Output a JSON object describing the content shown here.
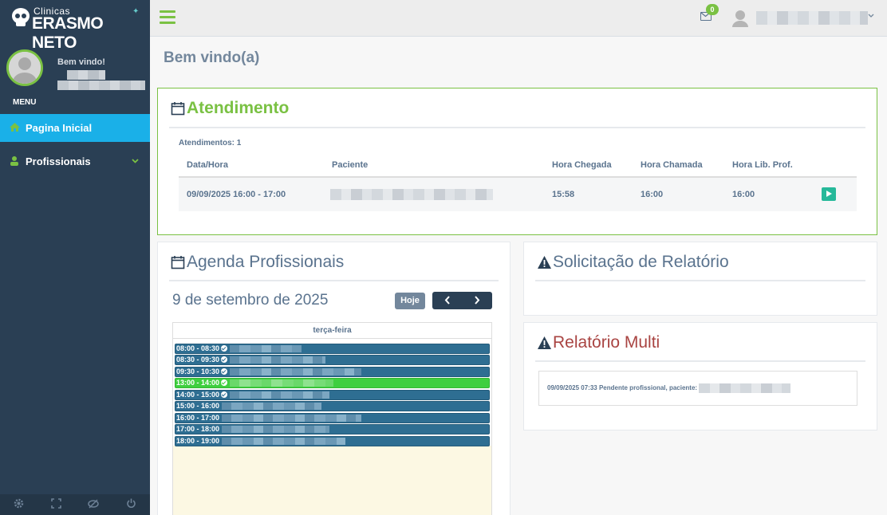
{
  "sidebar": {
    "logo_top": "Clinicas",
    "logo_main": "ERASMO NETO",
    "welcome": "Bem vindo!",
    "menu_label": "MENU",
    "items": [
      {
        "label": "Pagina Inicial",
        "icon": "home-icon",
        "active": true
      },
      {
        "label": "Profissionais",
        "icon": "users-icon",
        "active": false
      }
    ],
    "footer_icons": [
      "gear-icon",
      "fullscreen-icon",
      "eye-slash-icon",
      "power-icon"
    ]
  },
  "topbar": {
    "mail_badge": "0"
  },
  "page": {
    "title": "Bem vindo(a)"
  },
  "atendimento": {
    "title": "Atendimento",
    "count_label": "Atendimentos: 1",
    "columns": [
      "Data/Hora",
      "Paciente",
      "Hora Chegada",
      "Hora Chamada",
      "Hora Lib. Prof."
    ],
    "rows": [
      {
        "data_hora": "09/09/2025 16:00 - 17:00",
        "hora_chegada": "15:58",
        "hora_chamada": "16:00",
        "hora_lib": "16:00"
      }
    ]
  },
  "agenda": {
    "title": "Agenda Profissionais",
    "date": "9 de setembro de 2025",
    "today_label": "Hoje",
    "prev_label": "‹",
    "next_label": "›",
    "weekday": "terça-feira",
    "events": [
      {
        "time": "08:00 - 08:30",
        "checked": true,
        "green": false
      },
      {
        "time": "08:30 - 09:30",
        "checked": true,
        "green": false
      },
      {
        "time": "09:30 - 10:30",
        "checked": true,
        "green": false
      },
      {
        "time": "13:00 - 14:00",
        "checked": true,
        "green": true
      },
      {
        "time": "14:00 - 15:00",
        "checked": true,
        "green": false
      },
      {
        "time": "15:00 - 16:00",
        "checked": false,
        "green": false
      },
      {
        "time": "16:00 - 17:00",
        "checked": false,
        "green": false
      },
      {
        "time": "17:00 - 18:00",
        "checked": false,
        "green": false
      },
      {
        "time": "18:00 - 19:00",
        "checked": false,
        "green": false
      }
    ]
  },
  "solicitacao": {
    "title": "Solicitação de Relatório"
  },
  "relatorio": {
    "title": "Relatório Multi",
    "entry": "09/09/2025 07:33 Pendente profissional, paciente:"
  },
  "colors": {
    "sidebar": "#2a3f54",
    "accent_green": "#7ac143",
    "active_blue": "#1ab0e8",
    "event_blue": "#2e6e92",
    "event_green": "#3fcf3f",
    "report_red": "#a94442"
  }
}
